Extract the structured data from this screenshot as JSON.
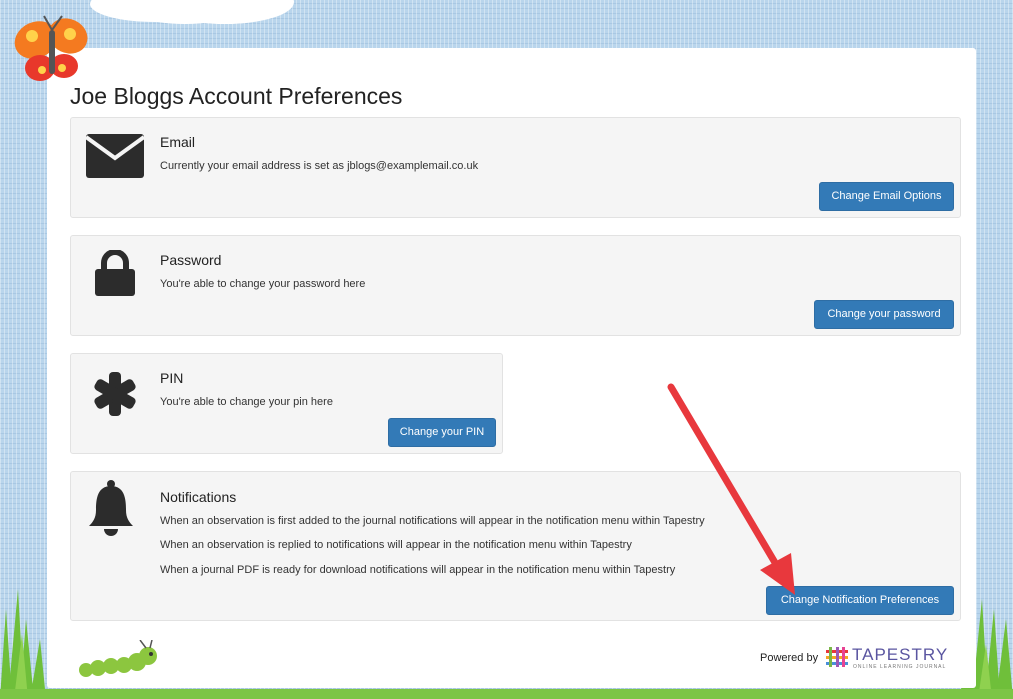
{
  "page": {
    "title": "Joe Bloggs Account Preferences"
  },
  "sections": {
    "email": {
      "heading": "Email",
      "lines": [
        "Currently your email address is set as jblogs@examplemail.co.uk"
      ],
      "button": "Change Email Options",
      "icon": "envelope-icon"
    },
    "password": {
      "heading": "Password",
      "lines": [
        "You're able to change your password here"
      ],
      "button": "Change your password",
      "icon": "lock-icon"
    },
    "pin": {
      "heading": "PIN",
      "lines": [
        "You're able to change your pin here"
      ],
      "button": "Change your PIN",
      "icon": "asterisk-icon"
    },
    "notifications": {
      "heading": "Notifications",
      "lines": [
        "When an observation is first added to the journal notifications will appear in the notification menu within Tapestry",
        "When an observation is replied to notifications will appear in the notification menu within Tapestry",
        "When a journal PDF is ready for download notifications will appear in the notification menu within Tapestry"
      ],
      "button": "Change Notification Preferences",
      "icon": "bell-icon"
    }
  },
  "footer": {
    "powered_by": "Powered by",
    "brand": "TAPESTRY",
    "brand_tagline": "ONLINE LEARNING JOURNAL"
  },
  "colors": {
    "button": "#337ab7",
    "arrow": "#e8383d",
    "background": "#b9d5ec"
  }
}
